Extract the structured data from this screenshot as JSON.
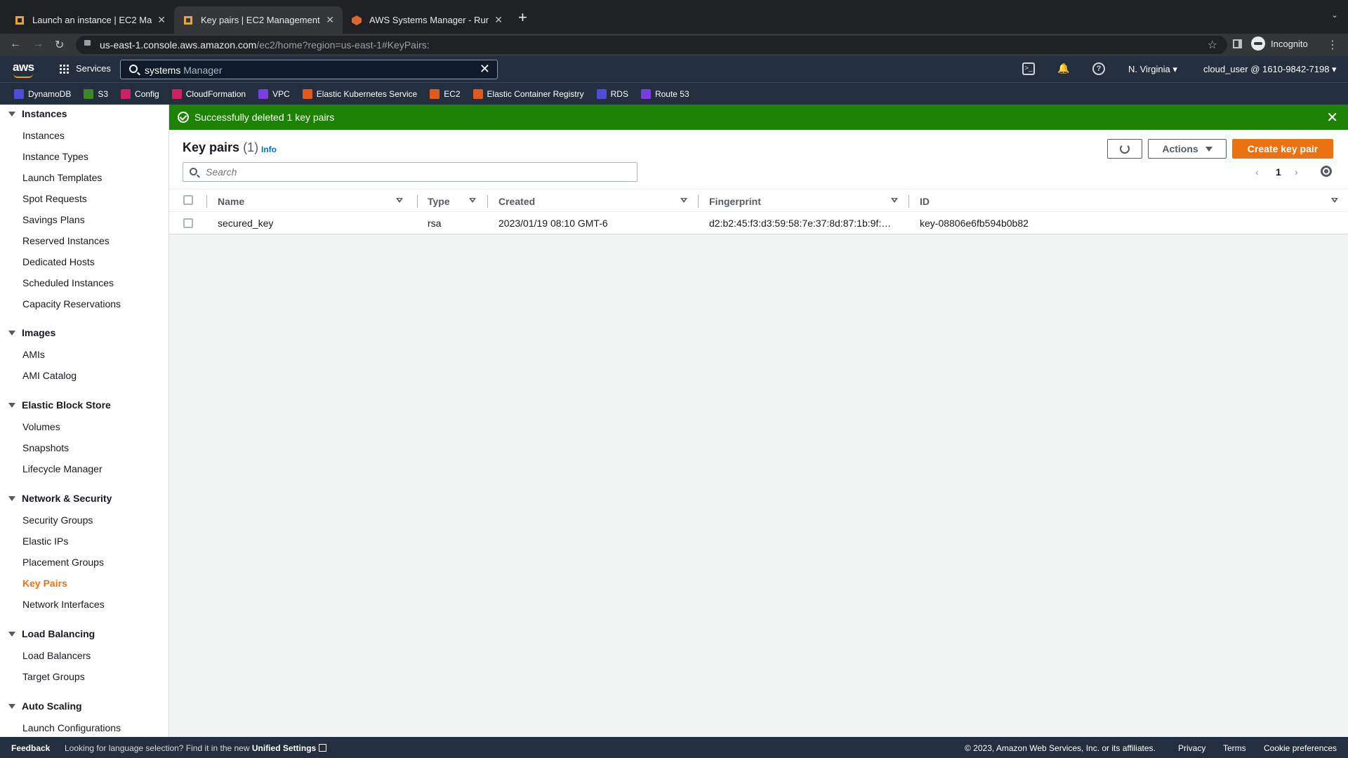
{
  "browser": {
    "tabs": [
      {
        "title": "Launch an instance | EC2 Mana…",
        "favicon_color": "#e8a33d"
      },
      {
        "title": "Key pairs | EC2 Management C…",
        "favicon_color": "#e8a33d"
      },
      {
        "title": "AWS Systems Manager - Run C…",
        "favicon_color": "#e0662e"
      }
    ],
    "url_host": "us-east-1.console.aws.amazon.com",
    "url_path": "/ec2/home?region=us-east-1#KeyPairs:",
    "profile_label": "Incognito",
    "icons": [
      "back-icon",
      "forward-icon",
      "reload-icon",
      "lock-icon",
      "star-icon",
      "side-panel-icon",
      "menu-icon"
    ]
  },
  "aws_nav": {
    "logo": "aws",
    "services_label": "Services",
    "search_typed": "systems",
    "search_suggestion": " Manager",
    "region": "N. Virginia",
    "account": "cloud_user @ 1610-9842-7198",
    "icons": [
      "cloudshell-icon",
      "bell-icon",
      "help-icon"
    ]
  },
  "favorites": [
    {
      "label": "DynamoDB",
      "color": "#4d4dd8"
    },
    {
      "label": "S3",
      "color": "#3f8624"
    },
    {
      "label": "Config",
      "color": "#cc2264"
    },
    {
      "label": "CloudFormation",
      "color": "#cc2264"
    },
    {
      "label": "VPC",
      "color": "#7a3ee0"
    },
    {
      "label": "Elastic Kubernetes Service",
      "color": "#e05a1d"
    },
    {
      "label": "EC2",
      "color": "#e05a1d"
    },
    {
      "label": "Elastic Container Registry",
      "color": "#e05a1d"
    },
    {
      "label": "RDS",
      "color": "#4d4dd8"
    },
    {
      "label": "Route 53",
      "color": "#7a3ee0"
    }
  ],
  "sidebar": {
    "sections": [
      {
        "title": "Instances",
        "items": [
          "Instances",
          "Instance Types",
          "Launch Templates",
          "Spot Requests",
          "Savings Plans",
          "Reserved Instances",
          "Dedicated Hosts",
          "Scheduled Instances",
          "Capacity Reservations"
        ]
      },
      {
        "title": "Images",
        "items": [
          "AMIs",
          "AMI Catalog"
        ]
      },
      {
        "title": "Elastic Block Store",
        "items": [
          "Volumes",
          "Snapshots",
          "Lifecycle Manager"
        ]
      },
      {
        "title": "Network & Security",
        "items": [
          "Security Groups",
          "Elastic IPs",
          "Placement Groups",
          "Key Pairs",
          "Network Interfaces"
        ]
      },
      {
        "title": "Load Balancing",
        "items": [
          "Load Balancers",
          "Target Groups"
        ]
      },
      {
        "title": "Auto Scaling",
        "items": [
          "Launch Configurations"
        ]
      }
    ],
    "active_item": "Key Pairs"
  },
  "flash": {
    "message": "Successfully deleted 1 key pairs",
    "color": "#1d8102"
  },
  "panel": {
    "title": "Key pairs",
    "count": "(1)",
    "info_label": "Info",
    "actions_label": "Actions",
    "create_label": "Create key pair",
    "search_placeholder": "Search",
    "page": "1",
    "prev_arrow": "‹",
    "next_arrow": "›"
  },
  "table": {
    "columns": [
      "Name",
      "Type",
      "Created",
      "Fingerprint",
      "ID"
    ],
    "rows": [
      {
        "name": "secured_key",
        "type": "rsa",
        "created": "2023/01/19 08:10 GMT-6",
        "fingerprint": "d2:b2:45:f3:d3:59:58:7e:37:8d:87:1b:9f:…",
        "id": "key-08806e6fb594b0b82"
      }
    ]
  },
  "footer": {
    "feedback": "Feedback",
    "lang_text": "Looking for language selection? Find it in the new",
    "lang_link": "Unified Settings",
    "copyright": "© 2023, Amazon Web Services, Inc. or its affiliates.",
    "links": [
      "Privacy",
      "Terms",
      "Cookie preferences"
    ]
  },
  "colors": {
    "aws_orange": "#ec7211",
    "aws_navy": "#232f3e",
    "link_blue": "#0073bb"
  }
}
